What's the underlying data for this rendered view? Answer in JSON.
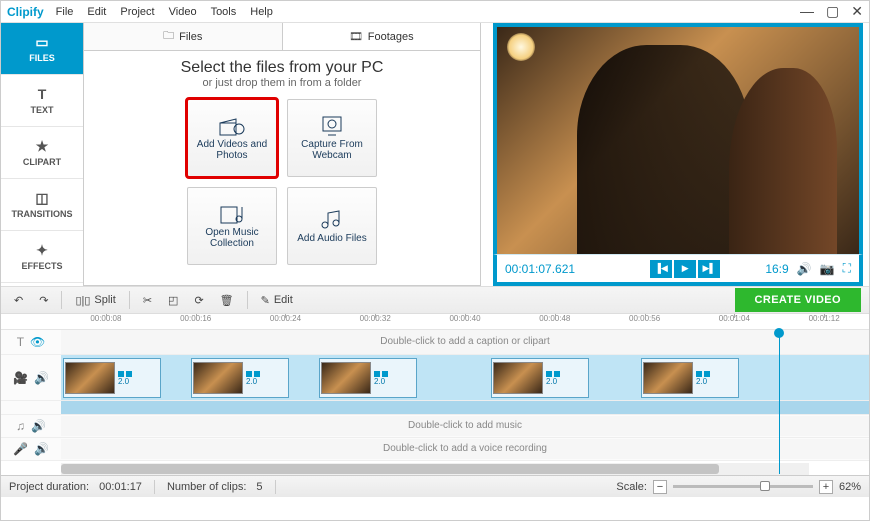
{
  "app_name": "Clipify",
  "menu": [
    "File",
    "Edit",
    "Project",
    "Video",
    "Tools",
    "Help"
  ],
  "sidebar": [
    {
      "label": "FILES",
      "icon": "image-icon",
      "active": true
    },
    {
      "label": "TEXT",
      "icon": "text-icon"
    },
    {
      "label": "CLIPART",
      "icon": "star-icon"
    },
    {
      "label": "TRANSITIONS",
      "icon": "transition-icon"
    },
    {
      "label": "EFFECTS",
      "icon": "sparkle-icon"
    }
  ],
  "center_tabs": {
    "files": "Files",
    "footages": "Footages"
  },
  "center_header": {
    "title": "Select the files from your PC",
    "subtitle": "or just drop them in from a folder"
  },
  "cards": {
    "add_videos": "Add Videos and Photos",
    "webcam": "Capture From Webcam",
    "music": "Open Music Collection",
    "audio": "Add Audio Files"
  },
  "preview": {
    "timecode": "00:01:07.621",
    "aspect": "16:9"
  },
  "toolbar": {
    "split": "Split",
    "edit": "Edit",
    "create": "CREATE VIDEO"
  },
  "timeline": {
    "ticks": [
      "00:00:08",
      "00:00:16",
      "00:00:24",
      "00:00:32",
      "00:00:40",
      "00:00:48",
      "00:00:56",
      "00:01:04",
      "00:01:12"
    ],
    "caption_hint": "Double-click to add a caption or clipart",
    "music_hint": "Double-click to add music",
    "voice_hint": "Double-click to add a voice recording",
    "clip_duration": "2.0"
  },
  "status": {
    "project_label": "Project duration:",
    "project_value": "00:01:17",
    "clips_label": "Number of clips:",
    "clips_value": "5",
    "scale_label": "Scale:",
    "zoom_value": "62%"
  }
}
